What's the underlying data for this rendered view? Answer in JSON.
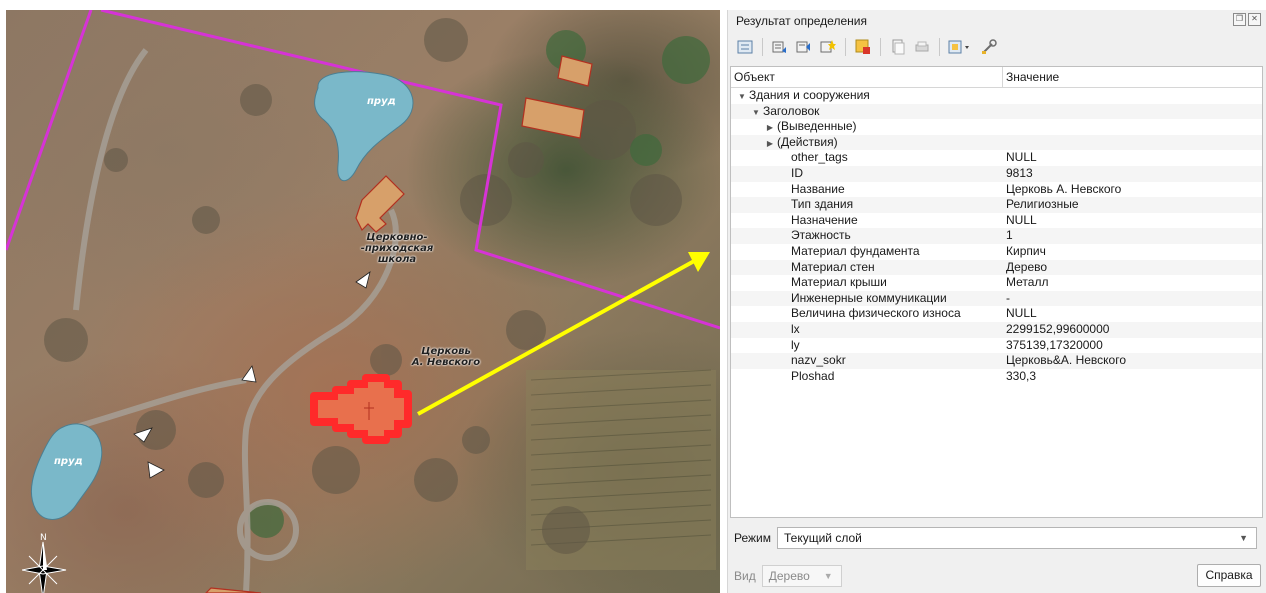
{
  "map": {
    "labels": {
      "pond_top": "пруд",
      "pond_bottom": "пруд",
      "school": "Церковно-\n-приходская\nшкола",
      "church": "Церковь\nА. Невского",
      "north": "N"
    },
    "colors": {
      "boundary": "#d633d6",
      "pond": "#7ab8c9",
      "building": "#d7a06a",
      "highlight": "#ff2a2a",
      "arrow": "#ffff00"
    }
  },
  "panel": {
    "title": "Результат определения",
    "window_buttons": [
      "restore-icon",
      "close-icon"
    ],
    "toolbar": [
      "expand-tree-icon",
      "expand-all-icon",
      "collapse-all-icon",
      "expand-new-icon",
      "clear-highlights-icon",
      "copy-feature-icon",
      "print-icon",
      "select-features-icon",
      "settings-icon"
    ],
    "columns": [
      "Объект",
      "Значение"
    ],
    "rows": [
      {
        "indent": 0,
        "arrow": "▼",
        "key": "Здания и сооружения",
        "value": ""
      },
      {
        "indent": 1,
        "arrow": "▼",
        "key": "Заголовок",
        "value": ""
      },
      {
        "indent": 2,
        "arrow": "▶",
        "key": "(Выведенные)",
        "value": ""
      },
      {
        "indent": 2,
        "arrow": "▶",
        "key": "(Действия)",
        "value": ""
      },
      {
        "indent": 3,
        "arrow": "",
        "key": "other_tags",
        "value": "NULL"
      },
      {
        "indent": 3,
        "arrow": "",
        "key": "ID",
        "value": "9813"
      },
      {
        "indent": 3,
        "arrow": "",
        "key": "Название",
        "value": "Церковь А. Невского"
      },
      {
        "indent": 3,
        "arrow": "",
        "key": "Тип здания",
        "value": "Религиозные"
      },
      {
        "indent": 3,
        "arrow": "",
        "key": "Назначение",
        "value": "NULL"
      },
      {
        "indent": 3,
        "arrow": "",
        "key": "Этажность",
        "value": "1"
      },
      {
        "indent": 3,
        "arrow": "",
        "key": "Материал фундамента",
        "value": "Кирпич"
      },
      {
        "indent": 3,
        "arrow": "",
        "key": "Материал стен",
        "value": "Дерево"
      },
      {
        "indent": 3,
        "arrow": "",
        "key": "Материал крыши",
        "value": "Металл"
      },
      {
        "indent": 3,
        "arrow": "",
        "key": "Инженерные коммуникации",
        "value": "-"
      },
      {
        "indent": 3,
        "arrow": "",
        "key": "Величина физического износа",
        "value": "NULL"
      },
      {
        "indent": 3,
        "arrow": "",
        "key": "lx",
        "value": "2299152,99600000"
      },
      {
        "indent": 3,
        "arrow": "",
        "key": "ly",
        "value": "375139,17320000"
      },
      {
        "indent": 3,
        "arrow": "",
        "key": "nazv_sokr",
        "value": "Церковь&А. Невского"
      },
      {
        "indent": 3,
        "arrow": "",
        "key": "Ploshad",
        "value": "330,3"
      }
    ],
    "mode_label": "Режим",
    "mode_value": "Текущий слой",
    "view_label": "Вид",
    "view_value": "Дерево",
    "help_label": "Справка"
  }
}
